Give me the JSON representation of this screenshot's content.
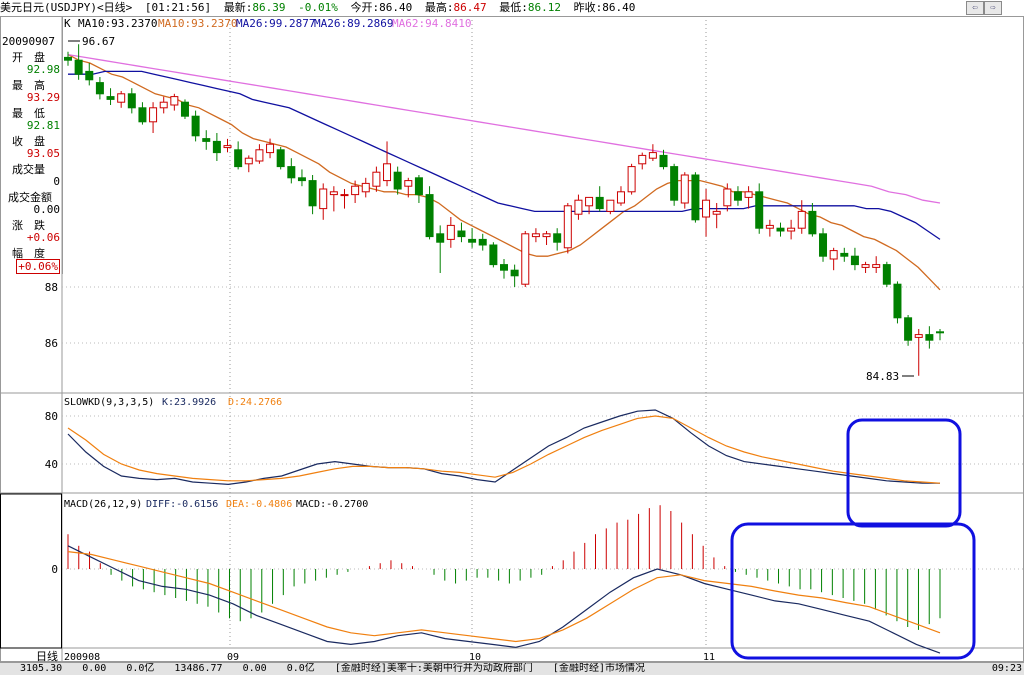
{
  "header": {
    "title": "美元日元(USDJPY)<日线>",
    "time": "[01:21:56]",
    "latest_label": "最新:",
    "latest_value": "86.39",
    "change_pct": "-0.01%",
    "open_label": "今开:",
    "open_value": "86.40",
    "high_label": "最高:",
    "high_value": "86.47",
    "low_label": "最低:",
    "low_value": "86.12",
    "prev_label": "昨收:",
    "prev_value": "86.40"
  },
  "nav_buttons": [
    "⇦",
    "⇨"
  ],
  "legend": {
    "k": "K",
    "ma10a": "MA10:93.2370",
    "ma10b": "MA10:93.2370",
    "ma26a": "MA26:99.2877",
    "ma26b": "MA26:89.2869",
    "ma62": "MA62:94.8410"
  },
  "info_panel": {
    "date": "20090907",
    "rows": [
      {
        "label": "开　盘",
        "value": "92.98"
      },
      {
        "label": "最　高",
        "value": "93.29"
      },
      {
        "label": "最　低",
        "value": "92.81"
      },
      {
        "label": "收　盘",
        "value": "93.05"
      },
      {
        "label": "成交量",
        "value": "0"
      },
      {
        "label": "成交金额",
        "value": "0.00"
      },
      {
        "label": "涨　跌",
        "value": "+0.06"
      },
      {
        "label": "幅　度",
        "value": "+0.06%"
      }
    ]
  },
  "price_axis": [
    "88",
    "86"
  ],
  "annotations": {
    "high_marker": "96.67",
    "low_marker": "84.83"
  },
  "kd_panel": {
    "label": "SLOWKD(9,3,3,5)",
    "k": "K:23.9926",
    "d": "D:24.2766",
    "axis": [
      "80",
      "40"
    ]
  },
  "macd_panel": {
    "label": "MACD(26,12,9)",
    "diff": "DIFF:-0.6156",
    "dea": "DEA:-0.4806",
    "macd": "MACD:-0.2700",
    "axis": [
      "0"
    ]
  },
  "x_axis": {
    "period_label": "日线",
    "ticks": [
      "200908",
      "09",
      "10",
      "11"
    ]
  },
  "statusbar": {
    "items": [
      "3105.30",
      "0.00",
      "0.0亿",
      "13486.77",
      "0.00",
      "0.0亿",
      "[金融时经]美率十:美朝中行并为动政府部门",
      "[金融时经]市场情况"
    ],
    "clock": "09:23"
  },
  "colors": {
    "up": "#cc0000",
    "down": "#008000",
    "ma10": "#d06a20",
    "ma26": "#1010a0",
    "ma62": "#e070e0",
    "kd_k": "#1a2a60",
    "kd_d": "#f08010",
    "dea": "#f08010",
    "diff": "#1a2a60",
    "highlight": "#1010e0"
  },
  "chart_data": [
    {
      "type": "candlestick",
      "title": "美元日元(USDJPY)<日线>",
      "x_ticks": [
        "200908",
        "09",
        "10",
        "11"
      ],
      "y_ticks": [
        88,
        86
      ],
      "ylim": [
        84.5,
        97.0
      ],
      "candles": [
        [
          96.2,
          96.4,
          95.9,
          96.1
        ],
        [
          96.1,
          96.67,
          95.4,
          95.6
        ],
        [
          95.7,
          96.0,
          95.2,
          95.4
        ],
        [
          95.3,
          95.5,
          94.7,
          94.9
        ],
        [
          94.8,
          95.1,
          94.5,
          94.7
        ],
        [
          94.6,
          95.0,
          94.4,
          94.9
        ],
        [
          94.9,
          95.1,
          94.2,
          94.4
        ],
        [
          94.4,
          94.6,
          93.8,
          93.9
        ],
        [
          93.9,
          94.6,
          93.5,
          94.4
        ],
        [
          94.4,
          94.8,
          94.2,
          94.6
        ],
        [
          94.5,
          94.9,
          94.3,
          94.8
        ],
        [
          94.6,
          94.7,
          94.0,
          94.1
        ],
        [
          94.1,
          94.3,
          93.2,
          93.4
        ],
        [
          93.3,
          93.6,
          92.9,
          93.2
        ],
        [
          93.2,
          93.5,
          92.5,
          92.8
        ],
        [
          92.98,
          93.29,
          92.81,
          93.05
        ],
        [
          92.9,
          93.2,
          92.2,
          92.3
        ],
        [
          92.4,
          92.7,
          92.1,
          92.6
        ],
        [
          92.5,
          93.1,
          92.4,
          92.9
        ],
        [
          92.8,
          93.3,
          92.6,
          93.1
        ],
        [
          92.9,
          93.0,
          92.2,
          92.3
        ],
        [
          92.3,
          92.6,
          91.7,
          91.9
        ],
        [
          91.9,
          92.2,
          91.6,
          91.8
        ],
        [
          91.8,
          92.0,
          90.6,
          90.9
        ],
        [
          90.8,
          91.7,
          90.4,
          91.5
        ],
        [
          91.3,
          91.6,
          90.7,
          91.4
        ],
        [
          91.3,
          91.5,
          90.8,
          91.3
        ],
        [
          91.3,
          91.8,
          91.0,
          91.6
        ],
        [
          91.4,
          91.9,
          91.2,
          91.7
        ],
        [
          91.6,
          92.3,
          91.4,
          92.1
        ],
        [
          91.8,
          93.2,
          91.6,
          92.4
        ],
        [
          92.1,
          92.3,
          91.3,
          91.5
        ],
        [
          91.6,
          91.9,
          91.2,
          91.8
        ],
        [
          91.9,
          92.0,
          91.0,
          91.3
        ],
        [
          91.3,
          91.6,
          89.7,
          89.8
        ],
        [
          89.9,
          90.2,
          88.5,
          89.6
        ],
        [
          89.7,
          90.5,
          89.4,
          90.2
        ],
        [
          90.0,
          90.3,
          89.6,
          89.8
        ],
        [
          89.7,
          90.1,
          89.4,
          89.6
        ],
        [
          89.7,
          89.9,
          89.3,
          89.5
        ],
        [
          89.5,
          89.6,
          88.7,
          88.8
        ],
        [
          88.8,
          89.0,
          88.3,
          88.6
        ],
        [
          88.6,
          88.8,
          88.0,
          88.4
        ],
        [
          88.1,
          90.0,
          88.0,
          89.9
        ],
        [
          89.8,
          90.1,
          89.6,
          89.9
        ],
        [
          89.8,
          90.0,
          89.5,
          89.9
        ],
        [
          89.9,
          90.1,
          89.3,
          89.6
        ],
        [
          89.4,
          91.0,
          89.2,
          90.9
        ],
        [
          90.6,
          91.3,
          90.4,
          91.1
        ],
        [
          90.9,
          91.2,
          90.6,
          91.2
        ],
        [
          91.2,
          91.6,
          90.7,
          90.8
        ],
        [
          90.7,
          91.1,
          90.6,
          91.1
        ],
        [
          91.0,
          91.6,
          90.9,
          91.4
        ],
        [
          91.4,
          92.4,
          91.3,
          92.3
        ],
        [
          92.4,
          92.8,
          92.2,
          92.7
        ],
        [
          92.6,
          93.1,
          92.5,
          92.8
        ],
        [
          92.7,
          92.9,
          92.2,
          92.3
        ],
        [
          92.3,
          92.4,
          90.9,
          91.1
        ],
        [
          91.0,
          92.1,
          90.8,
          92.0
        ],
        [
          92.0,
          92.1,
          90.3,
          90.4
        ],
        [
          90.5,
          91.5,
          89.8,
          91.1
        ],
        [
          90.6,
          91.0,
          90.1,
          90.7
        ],
        [
          90.9,
          91.7,
          90.7,
          91.5
        ],
        [
          91.4,
          91.6,
          90.9,
          91.1
        ],
        [
          91.2,
          91.6,
          90.8,
          91.4
        ],
        [
          91.4,
          91.7,
          89.9,
          90.1
        ],
        [
          90.1,
          90.4,
          89.8,
          90.2
        ],
        [
          90.1,
          90.3,
          89.8,
          90.0
        ],
        [
          90.0,
          90.4,
          89.7,
          90.1
        ],
        [
          90.1,
          91.1,
          89.9,
          90.7
        ],
        [
          90.7,
          91.0,
          89.8,
          89.9
        ],
        [
          89.9,
          90.1,
          88.9,
          89.1
        ],
        [
          89.0,
          89.4,
          88.6,
          89.3
        ],
        [
          89.2,
          89.4,
          88.9,
          89.1
        ],
        [
          89.1,
          89.4,
          88.6,
          88.8
        ],
        [
          88.7,
          88.9,
          88.5,
          88.8
        ],
        [
          88.7,
          89.1,
          88.5,
          88.8
        ],
        [
          88.8,
          88.9,
          88.0,
          88.1
        ],
        [
          88.1,
          88.2,
          86.7,
          86.9
        ],
        [
          86.9,
          87.0,
          85.9,
          86.1
        ],
        [
          86.2,
          86.5,
          84.83,
          86.3
        ],
        [
          86.3,
          86.6,
          85.8,
          86.1
        ],
        [
          86.4,
          86.5,
          86.1,
          86.39
        ]
      ],
      "series": [
        {
          "name": "MA10",
          "values": [
            96.3,
            96.1,
            96.0,
            95.8,
            95.6,
            95.5,
            95.3,
            95.1,
            94.9,
            94.8,
            94.7,
            94.5,
            94.4,
            94.2,
            94.0,
            93.8,
            93.5,
            93.3,
            93.2,
            93.1,
            93.0,
            92.8,
            92.6,
            92.4,
            92.1,
            91.9,
            91.7,
            91.6,
            91.5,
            91.4,
            91.4,
            91.3,
            91.3,
            91.2,
            91.0,
            90.7,
            90.4,
            90.2,
            90.0,
            89.8,
            89.6,
            89.4,
            89.2,
            89.1,
            89.1,
            89.2,
            89.3,
            89.5,
            89.8,
            90.1,
            90.4,
            90.7,
            90.9,
            91.2,
            91.5,
            91.7,
            91.8,
            91.8,
            91.8,
            91.7,
            91.6,
            91.4,
            91.4,
            91.3,
            91.2,
            91.1,
            91.0,
            90.8,
            90.6,
            90.5,
            90.3,
            90.2,
            90.0,
            89.8,
            89.7,
            89.5,
            89.3,
            89.0,
            88.7,
            88.3,
            87.9
          ]
        },
        {
          "name": "MA26",
          "values": [
            95.6,
            95.6,
            95.6,
            95.7,
            95.7,
            95.7,
            95.7,
            95.6,
            95.5,
            95.4,
            95.3,
            95.2,
            95.1,
            95.0,
            94.9,
            94.7,
            94.6,
            94.5,
            94.4,
            94.2,
            94.0,
            93.8,
            93.6,
            93.4,
            93.2,
            93.0,
            92.8,
            92.6,
            92.4,
            92.2,
            92.0,
            91.8,
            91.6,
            91.4,
            91.2,
            91.0,
            90.9,
            90.8,
            90.7,
            90.7,
            90.7,
            90.7,
            90.7,
            90.7,
            90.7,
            90.7,
            90.7,
            90.7,
            90.7,
            90.7,
            90.7,
            90.8,
            90.8,
            90.8,
            90.8,
            90.8,
            90.9,
            90.9,
            90.9,
            90.9,
            90.9,
            90.9,
            90.9,
            90.9,
            90.9,
            90.8,
            90.8,
            90.7,
            90.5,
            90.3,
            90.0,
            89.7
          ]
        },
        {
          "name": "MA62",
          "values": [
            96.3,
            96.2,
            96.1,
            96.0,
            95.9,
            95.8,
            95.7,
            95.6,
            95.5,
            95.4,
            95.3,
            95.2,
            95.1,
            95.0,
            94.9,
            94.8,
            94.7,
            94.6,
            94.5,
            94.4,
            94.3,
            94.2,
            94.1,
            94.0,
            93.9,
            93.8,
            93.7,
            93.6,
            93.5,
            93.4,
            93.3,
            93.2,
            93.1,
            93.0,
            92.9,
            92.8,
            92.7,
            92.6,
            92.5,
            92.4,
            92.3,
            92.2,
            92.1,
            92.0,
            91.9,
            91.8,
            91.7,
            91.6,
            91.4,
            91.3,
            91.1,
            91.0
          ]
        }
      ]
    },
    {
      "type": "line",
      "title": "SLOWKD(9,3,3,5)",
      "ylim": [
        20,
        95
      ],
      "y_ticks": [
        80,
        40
      ],
      "series": [
        {
          "name": "K",
          "values": [
            65,
            50,
            38,
            30,
            28,
            27,
            28,
            25,
            24,
            23,
            25,
            28,
            30,
            35,
            40,
            42,
            40,
            38,
            37,
            37,
            36,
            32,
            30,
            27,
            25,
            35,
            45,
            55,
            62,
            70,
            75,
            80,
            84,
            85,
            78,
            66,
            55,
            47,
            42,
            40,
            38,
            36,
            34,
            32,
            30,
            28,
            26,
            25,
            24,
            24
          ]
        },
        {
          "name": "D",
          "values": [
            70,
            60,
            48,
            40,
            35,
            32,
            30,
            28,
            27,
            26,
            26,
            27,
            28,
            30,
            33,
            36,
            38,
            38,
            37,
            37,
            36,
            34,
            33,
            31,
            29,
            33,
            40,
            48,
            55,
            62,
            68,
            73,
            78,
            80,
            78,
            70,
            62,
            55,
            50,
            46,
            43,
            40,
            37,
            34,
            32,
            30,
            28,
            26,
            25,
            24
          ]
        }
      ]
    },
    {
      "type": "bar",
      "title": "MACD(26,12,9)",
      "ylim": [
        -1.5,
        1.2
      ],
      "y_ticks": [
        0
      ],
      "values": [
        0.6,
        0.4,
        0.3,
        0.1,
        -0.1,
        -0.2,
        -0.3,
        -0.35,
        -0.4,
        -0.45,
        -0.5,
        -0.55,
        -0.6,
        -0.65,
        -0.75,
        -0.85,
        -0.9,
        -0.85,
        -0.75,
        -0.6,
        -0.45,
        -0.3,
        -0.25,
        -0.2,
        -0.15,
        -0.1,
        -0.05,
        0.0,
        0.05,
        0.1,
        0.15,
        0.1,
        0.05,
        0.0,
        -0.1,
        -0.2,
        -0.25,
        -0.2,
        -0.15,
        -0.15,
        -0.2,
        -0.25,
        -0.2,
        -0.15,
        -0.1,
        0.05,
        0.15,
        0.3,
        0.45,
        0.6,
        0.7,
        0.8,
        0.85,
        0.95,
        1.05,
        1.1,
        1.0,
        0.8,
        0.6,
        0.4,
        0.2,
        0.05,
        -0.05,
        -0.1,
        -0.15,
        -0.2,
        -0.25,
        -0.3,
        -0.35,
        -0.35,
        -0.4,
        -0.45,
        -0.5,
        -0.55,
        -0.6,
        -0.7,
        -0.8,
        -0.9,
        -1.0,
        -1.05,
        -0.95,
        -0.85
      ],
      "series": [
        {
          "name": "DIFF",
          "values": [
            0.4,
            0.2,
            0.0,
            -0.2,
            -0.3,
            -0.35,
            -0.45,
            -0.6,
            -0.8,
            -0.95,
            -1.1,
            -1.25,
            -1.3,
            -1.25,
            -1.15,
            -1.1,
            -1.2,
            -1.25,
            -1.3,
            -1.35,
            -1.25,
            -1.0,
            -0.7,
            -0.4,
            -0.15,
            0.0,
            -0.1,
            -0.25,
            -0.35,
            -0.45,
            -0.55,
            -0.6,
            -0.7,
            -0.8,
            -0.9,
            -1.1,
            -1.3,
            -1.45
          ]
        },
        {
          "name": "DEA",
          "values": [
            0.3,
            0.25,
            0.15,
            0.05,
            -0.05,
            -0.15,
            -0.25,
            -0.4,
            -0.55,
            -0.7,
            -0.85,
            -1.0,
            -1.1,
            -1.15,
            -1.1,
            -1.05,
            -1.1,
            -1.15,
            -1.2,
            -1.25,
            -1.2,
            -1.05,
            -0.85,
            -0.6,
            -0.35,
            -0.15,
            -0.1,
            -0.2,
            -0.25,
            -0.3,
            -0.38,
            -0.45,
            -0.5,
            -0.58,
            -0.65,
            -0.8,
            -0.95,
            -1.1
          ]
        }
      ]
    }
  ]
}
